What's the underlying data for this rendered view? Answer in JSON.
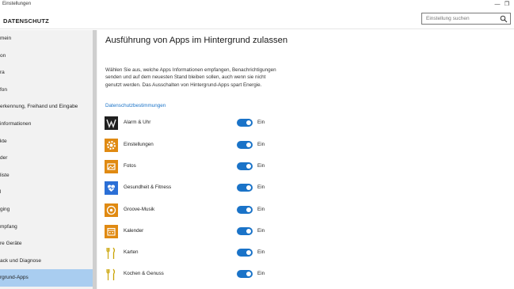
{
  "window": {
    "title": "Einstellungen",
    "minimize_glyph": "—",
    "maximize_glyph": "❐"
  },
  "header": {
    "section": "DATENSCHUTZ",
    "search_placeholder": "Einstellung suchen"
  },
  "sidebar": {
    "items": [
      {
        "label": "mein"
      },
      {
        "label": "on"
      },
      {
        "label": "ra"
      },
      {
        "label": "fon"
      },
      {
        "label": "erkennung, Freihand und Eingabe"
      },
      {
        "label": "informationen"
      },
      {
        "label": "kte"
      },
      {
        "label": "der"
      },
      {
        "label": "liste"
      },
      {
        "label": "l"
      },
      {
        "label": "ging"
      },
      {
        "label": "mpfang"
      },
      {
        "label": "re Geräte"
      },
      {
        "label": "ack und Diagnose"
      },
      {
        "label": "rgrund-Apps",
        "active": true
      }
    ]
  },
  "main": {
    "title": "Ausführung von Apps im Hintergrund zulassen",
    "description": "Wählen Sie aus, welche Apps Informationen empfangen, Benachrichtigungen senden und auf dem neuesten Stand bleiben sollen, auch wenn sie nicht genutzt werden. Das Ausschalten von Hintergrund-Apps spart Energie.",
    "privacy_link": "Datenschutzbestimmungen",
    "apps": [
      {
        "name": "Alarm & Uhr",
        "state": "Ein",
        "on": true,
        "tile_color": "#1f1f1f",
        "icon": "alarm-clock-icon"
      },
      {
        "name": "Einstellungen",
        "state": "Ein",
        "on": true,
        "tile_color": "#e08a12",
        "icon": "gear-icon"
      },
      {
        "name": "Fotos",
        "state": "Ein",
        "on": true,
        "tile_color": "#e08a12",
        "icon": "photos-icon"
      },
      {
        "name": "Gesundheit & Fitness",
        "state": "Ein",
        "on": true,
        "tile_color": "#2b6fd6",
        "icon": "heart-pulse-icon"
      },
      {
        "name": "Groove-Musik",
        "state": "Ein",
        "on": true,
        "tile_color": "#e08a12",
        "icon": "music-disc-icon"
      },
      {
        "name": "Kalender",
        "state": "Ein",
        "on": true,
        "tile_color": "#e08a12",
        "icon": "calendar-icon"
      },
      {
        "name": "Karten",
        "state": "Ein",
        "on": true,
        "tile_color": "#ffffff",
        "icon": "cutlery-icon"
      },
      {
        "name": "Kochen & Genuss",
        "state": "Ein",
        "on": true,
        "tile_color": "#ffffff",
        "icon": "cutlery-icon"
      }
    ]
  },
  "colors": {
    "accent": "#1a73c8",
    "sidebar_bg": "#f2f2f2",
    "sidebar_active": "#a9cdf0"
  }
}
